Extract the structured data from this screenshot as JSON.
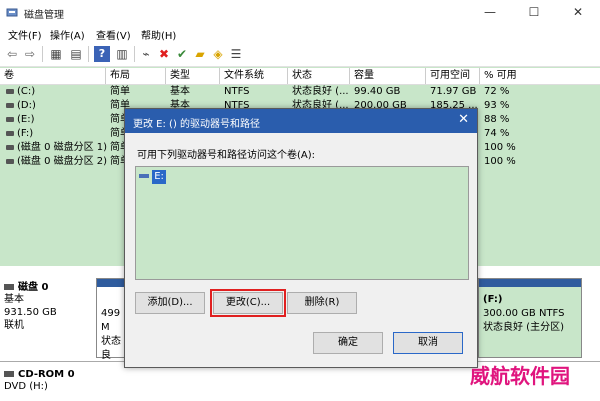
{
  "window": {
    "title": "磁盘管理",
    "min": "—",
    "max": "☐",
    "close": "✕"
  },
  "menu": [
    "文件(F)",
    "操作(A)",
    "查看(V)",
    "帮助(H)"
  ],
  "toolbar": {
    "icons": [
      "back-arrow-icon",
      "forward-arrow-icon",
      "console-tree-icon",
      "properties-icon",
      "help-icon",
      "view-icon",
      "connect-icon",
      "delete-icon",
      "folder-icon",
      "search-folder-icon",
      "details-icon"
    ]
  },
  "columns": [
    "卷",
    "布局",
    "类型",
    "文件系统",
    "状态",
    "容量",
    "可用空间",
    "% 可用"
  ],
  "volumes": [
    [
      "(C:)",
      "简单",
      "基本",
      "NTFS",
      "状态良好 (...",
      "99.40 GB",
      "71.97 GB",
      "72 %"
    ],
    [
      "(D:)",
      "简单",
      "基本",
      "NTFS",
      "状态良好 (...",
      "200.00 GB",
      "185.25 ...",
      "93 %"
    ],
    [
      "(E:)",
      "简单",
      "",
      "",
      "",
      "",
      "",
      "88 %"
    ],
    [
      "(F:)",
      "简单",
      "",
      "",
      "",
      "",
      "",
      "74 %"
    ],
    [
      "(磁盘 0 磁盘分区 1)",
      "简单",
      "",
      "",
      "",
      "",
      "",
      "100 %"
    ],
    [
      "(磁盘 0 磁盘分区 2)",
      "简单",
      "",
      "",
      "",
      "",
      "",
      "100 %"
    ]
  ],
  "disks": {
    "disk0": {
      "label": "磁盘 0",
      "type": "基本",
      "size": "931.50 GB",
      "status": "联机",
      "partition_left": {
        "line1": "499 M",
        "line2": "状态良"
      },
      "partition_f": {
        "name": "(F:)",
        "size": "300.00 GB NTFS",
        "status": "状态良好 (主分区)"
      }
    },
    "cdrom0": {
      "label": "CD-ROM 0",
      "drive": "DVD (H:)"
    }
  },
  "dialog": {
    "title": "更改 E: () 的驱动器号和路径",
    "instructions": "可用下列驱动器号和路径访问这个卷(A):",
    "list_items": [
      "E:"
    ],
    "add_button": "添加(D)...",
    "change_button": "更改(C)...",
    "remove_button": "删除(R)",
    "ok_button": "确定",
    "cancel_button": "取消"
  },
  "watermark": "威航软件园"
}
